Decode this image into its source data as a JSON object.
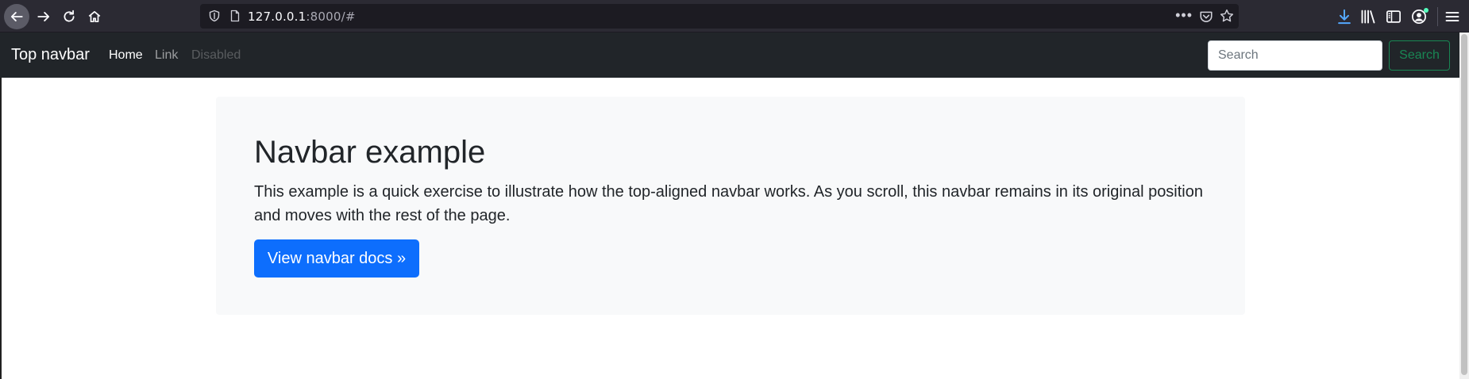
{
  "browser": {
    "url_host": "127.0.0.1",
    "url_rest": ":8000/#",
    "more_glyph": "•••"
  },
  "navbar": {
    "brand": "Top navbar",
    "links": [
      {
        "label": "Home",
        "state": "active"
      },
      {
        "label": "Link",
        "state": "normal"
      },
      {
        "label": "Disabled",
        "state": "disabled"
      }
    ],
    "search_placeholder": "Search",
    "search_button": "Search",
    "colors": {
      "background": "#212529",
      "search_button": "#198754"
    }
  },
  "main": {
    "title": "Navbar example",
    "lead": "This example is a quick exercise to illustrate how the top-aligned navbar works. As you scroll, this navbar remains in its original position and moves with the rest of the page.",
    "button": "View navbar docs »",
    "colors": {
      "panel": "#f8f9fa",
      "button": "#0d6efd"
    }
  },
  "icons": [
    "back-arrow-icon",
    "forward-arrow-icon",
    "reload-icon",
    "home-icon",
    "shield-icon",
    "page-icon",
    "pocket-icon",
    "star-icon",
    "download-icon",
    "library-icon",
    "sidebar-icon",
    "account-icon",
    "hamburger-menu-icon"
  ]
}
